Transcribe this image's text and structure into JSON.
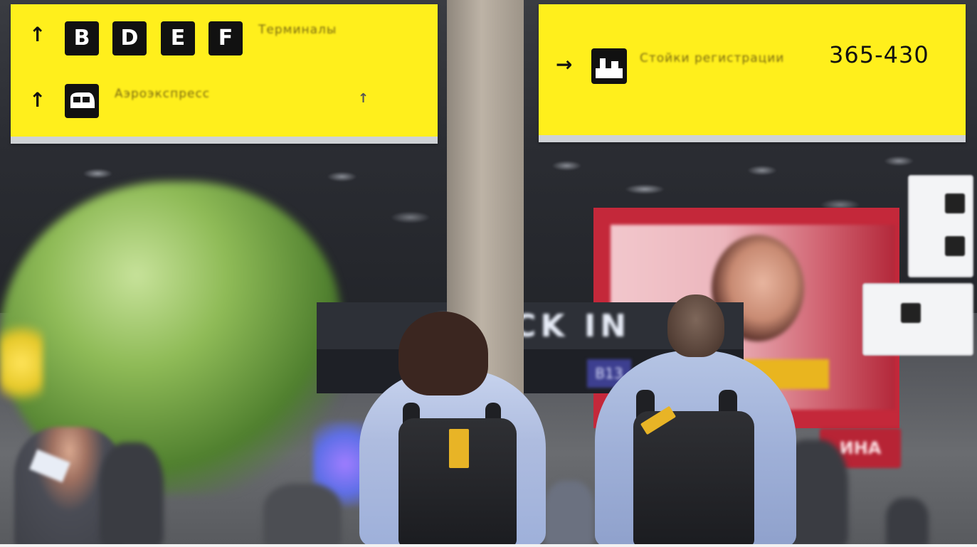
{
  "overhead_sign_left": {
    "letters": [
      "B",
      "D",
      "E",
      "F"
    ],
    "terminals_label": "Терминалы",
    "terminals_sub": "",
    "aeroexpress_label": "Аэроэкспресс",
    "aeroexpress_sub": "",
    "arrow_up_1": "↑",
    "arrow_up_2": "↑",
    "arrow_small": "↑"
  },
  "overhead_sign_right": {
    "arrow": "→",
    "checkin_label": "Стойки регистрации",
    "checkin_sub": "",
    "desk_range": "365-430"
  },
  "checkin_banner": {
    "text": "CHECK IN",
    "desk_number": "B13"
  },
  "store_sign": {
    "text": "ИНА"
  },
  "colors": {
    "sign_yellow": "#ffef1c",
    "sign_black": "#111111",
    "hoodie_blue": "#aebcdf",
    "billboard_red": "#c4283a"
  },
  "icons": {
    "left_sign_train": "train-icon",
    "right_sign_checkin": "checkin-desk-icon",
    "right_signs": [
      "wc-icon",
      "transit-icon",
      "elevator-icon"
    ]
  }
}
